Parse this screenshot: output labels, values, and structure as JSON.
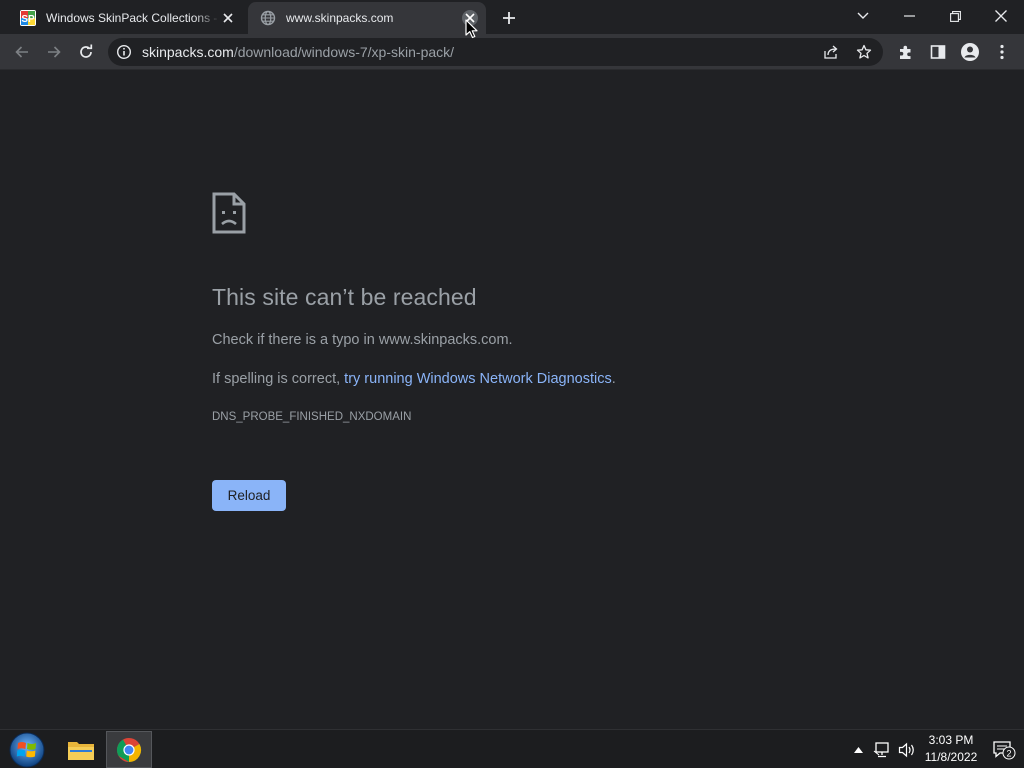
{
  "tabs": [
    {
      "title": "Windows SkinPack Collections - SkinPacks",
      "favicon": "skinpack-favicon",
      "active": false
    },
    {
      "title": "www.skinpacks.com",
      "favicon": "globe-icon",
      "active": true
    }
  ],
  "omnibox": {
    "host": "skinpacks.com",
    "path": "/download/windows-7/xp-skin-pack/"
  },
  "error": {
    "title": "This site can’t be reached",
    "line1": "Check if there is a typo in www.skinpacks.com.",
    "line2_prefix": "If spelling is correct, ",
    "line2_link": "try running Windows Network Diagnostics",
    "line2_suffix": ".",
    "code": "DNS_PROBE_FINISHED_NXDOMAIN",
    "reload_label": "Reload"
  },
  "taskbar": {
    "time": "3:03 PM",
    "date": "11/8/2022",
    "notification_count": "2"
  },
  "colors": {
    "background": "#202124",
    "toolbar": "#35363a",
    "link": "#8ab4f8",
    "text_secondary": "#9aa0a6"
  }
}
